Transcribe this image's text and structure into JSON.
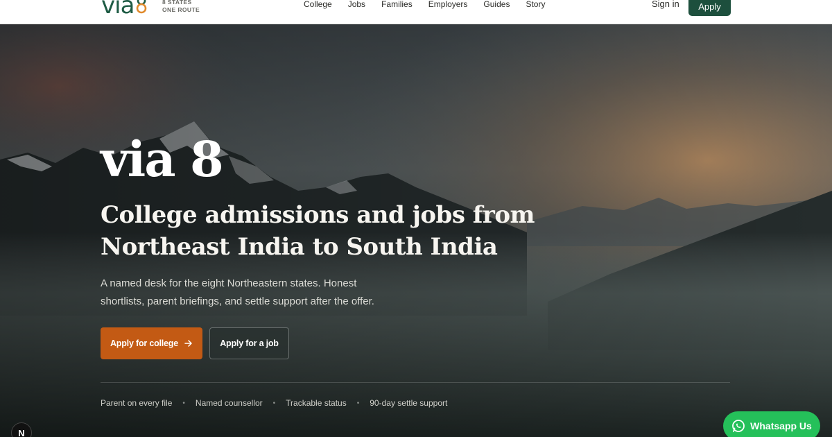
{
  "brand": {
    "logo_word": "via",
    "tagline_line1": "8 STATES",
    "tagline_line2": "ONE ROUTE",
    "colors": {
      "green": "#1e5b44",
      "orange": "#e08a2c"
    }
  },
  "nav": {
    "items": [
      {
        "label": "College"
      },
      {
        "label": "Jobs"
      },
      {
        "label": "Families"
      },
      {
        "label": "Employers"
      },
      {
        "label": "Guides"
      },
      {
        "label": "Story"
      }
    ],
    "signin_label": "Sign in",
    "apply_label": "Apply"
  },
  "hero": {
    "title": "via 8",
    "subtitle_line1": "College admissions and jobs from",
    "subtitle_line2": "Northeast India to South India",
    "description_line1": "A named desk for the eight Northeastern states. Honest",
    "description_line2": "shortlists, parent briefings, and settle support after the offer.",
    "primary_cta": "Apply for college",
    "primary_cta_icon": "arrow-right-icon",
    "secondary_cta": "Apply for a job",
    "features": [
      "Parent on every file",
      "Named counsellor",
      "Trackable status",
      "90-day settle support"
    ],
    "feature_separator": "•"
  },
  "floating": {
    "dev_badge_label": "N",
    "whatsapp_label": "Whatsapp Us",
    "whatsapp_icon": "whatsapp-icon"
  },
  "colors": {
    "accent_orange": "#c35a14",
    "dark_green": "#1d4f3d",
    "whatsapp_green": "#25c05a"
  }
}
